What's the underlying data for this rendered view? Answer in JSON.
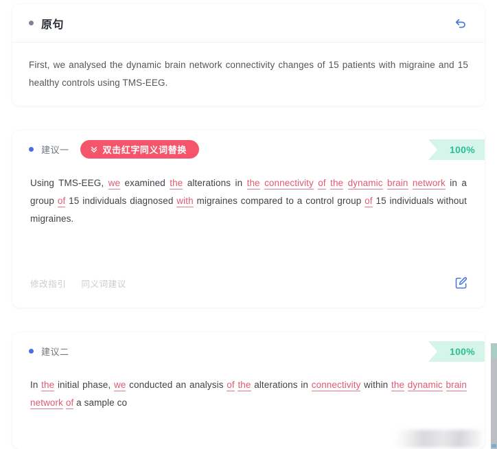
{
  "original_card": {
    "bullet": "gray-dot",
    "title": "原句",
    "undo_icon": "undo-arrow-icon",
    "text": "First, we analysed the dynamic brain network connectivity changes of 15 patients with migraine and 15 healthy controls using TMS-EEG."
  },
  "suggestions": [
    {
      "bullet": "blue-dot",
      "label": "建议一",
      "hint_pill": {
        "icon": "double-chevron-down-icon",
        "text": "双击红字同义词替换"
      },
      "score": "100%",
      "tokens": [
        {
          "t": "Using TMS-EEG, ",
          "hl": false
        },
        {
          "t": "we",
          "hl": true
        },
        {
          "t": " examined ",
          "hl": false
        },
        {
          "t": "the",
          "hl": true
        },
        {
          "t": " alterations in ",
          "hl": false
        },
        {
          "t": "the",
          "hl": true
        },
        {
          "t": " ",
          "hl": false
        },
        {
          "t": "connectivity",
          "hl": true
        },
        {
          "t": " ",
          "hl": false
        },
        {
          "t": "of",
          "hl": true
        },
        {
          "t": " ",
          "hl": false
        },
        {
          "t": "the",
          "hl": true
        },
        {
          "t": " ",
          "hl": false
        },
        {
          "t": "dynamic",
          "hl": true
        },
        {
          "t": " ",
          "hl": false
        },
        {
          "t": "brain",
          "hl": true
        },
        {
          "t": " ",
          "hl": false
        },
        {
          "t": "network",
          "hl": true
        },
        {
          "t": " in a group ",
          "hl": false
        },
        {
          "t": "of",
          "hl": true
        },
        {
          "t": " 15 individuals diagnosed ",
          "hl": false
        },
        {
          "t": "with",
          "hl": true
        },
        {
          "t": " migraines compared to a control group ",
          "hl": false
        },
        {
          "t": "of",
          "hl": true
        },
        {
          "t": " 15 individuals without migraines.",
          "hl": false
        }
      ],
      "footer": {
        "links": [
          "修改指引",
          "同义词建议"
        ],
        "edit_icon": "edit-pencil-square-icon"
      }
    },
    {
      "bullet": "blue-dot",
      "label": "建议二",
      "score": "100%",
      "tokens": [
        {
          "t": "In ",
          "hl": false
        },
        {
          "t": "the",
          "hl": true
        },
        {
          "t": " initial phase, ",
          "hl": false
        },
        {
          "t": "we",
          "hl": true
        },
        {
          "t": " conducted an analysis ",
          "hl": false
        },
        {
          "t": "of",
          "hl": true
        },
        {
          "t": " ",
          "hl": false
        },
        {
          "t": "the",
          "hl": true
        },
        {
          "t": " alterations in ",
          "hl": false
        },
        {
          "t": "connectivity",
          "hl": true
        },
        {
          "t": " within ",
          "hl": false
        },
        {
          "t": "the",
          "hl": true
        },
        {
          "t": " ",
          "hl": false
        },
        {
          "t": "dynamic",
          "hl": true
        },
        {
          "t": " ",
          "hl": false
        },
        {
          "t": "brain",
          "hl": true
        },
        {
          "t": " ",
          "hl": false
        },
        {
          "t": "network",
          "hl": true
        },
        {
          "t": " ",
          "hl": false
        },
        {
          "t": "of",
          "hl": true
        },
        {
          "t": " a sample co",
          "hl": false
        }
      ]
    }
  ],
  "colors": {
    "pill_pink": "#f4556a",
    "score_green_bg": "#d6f5ea",
    "score_green_text": "#2bbd94",
    "accent_blue": "#4a6fe3",
    "highlight_red": "#e05a72"
  }
}
